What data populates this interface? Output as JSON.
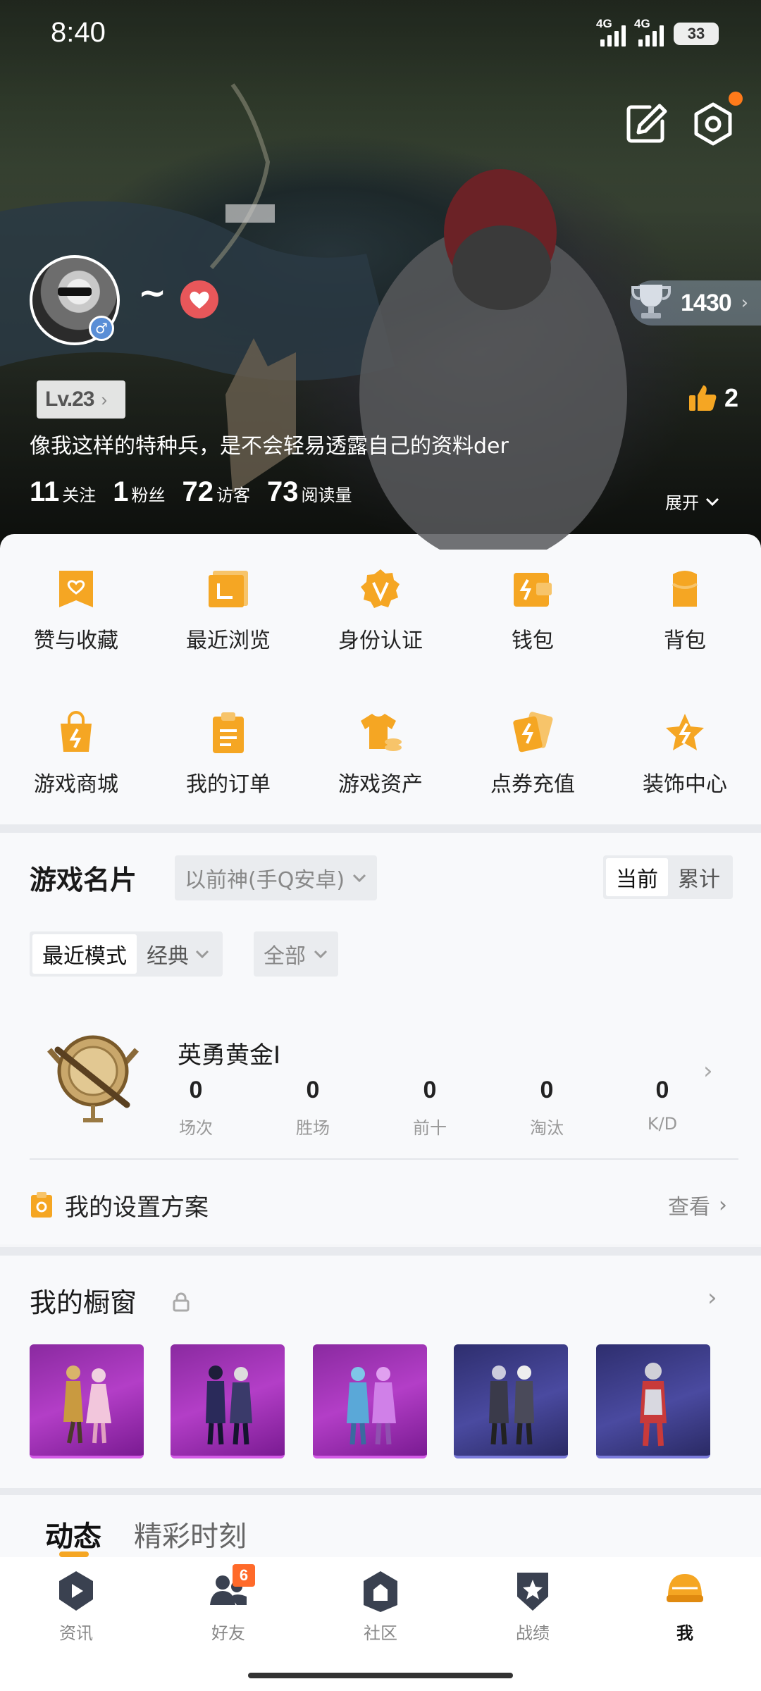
{
  "status_bar": {
    "time": "8:40",
    "network_1": "4G",
    "network_2": "4G",
    "battery": "33"
  },
  "profile": {
    "nickname": "~",
    "gender_symbol": "♂",
    "trophy_score": "1430",
    "level": "Lv.23",
    "likes": "2",
    "bio": "像我这样的特种兵，是不会轻易透露自己的资料der",
    "stats": [
      {
        "value": "11",
        "label": "关注"
      },
      {
        "value": "1",
        "label": "粉丝"
      },
      {
        "value": "72",
        "label": "访客"
      },
      {
        "value": "73",
        "label": "阅读量"
      }
    ],
    "expand_label": "展开"
  },
  "menu": [
    {
      "label": "赞与收藏",
      "icon": "bookmark-heart-icon"
    },
    {
      "label": "最近浏览",
      "icon": "recent-folder-icon"
    },
    {
      "label": "身份认证",
      "icon": "verified-badge-icon"
    },
    {
      "label": "钱包",
      "icon": "wallet-icon"
    },
    {
      "label": "背包",
      "icon": "backpack-icon"
    },
    {
      "label": "游戏商城",
      "icon": "shopping-bag-icon"
    },
    {
      "label": "我的订单",
      "icon": "clipboard-icon"
    },
    {
      "label": "游戏资产",
      "icon": "tshirt-coins-icon"
    },
    {
      "label": "点券充值",
      "icon": "coupon-cards-icon"
    },
    {
      "label": "装饰中心",
      "icon": "star-lightning-icon"
    }
  ],
  "game_card": {
    "title": "游戏名片",
    "account_dropdown": "以前神(手Q安卓)",
    "toggle": {
      "current": "当前",
      "cumulative": "累计"
    },
    "mode_recent": "最近模式",
    "mode_classic": "经典",
    "filter_all": "全部",
    "rank_name": "英勇黄金I",
    "rank_stats": [
      {
        "value": "0",
        "label": "场次"
      },
      {
        "value": "0",
        "label": "胜场"
      },
      {
        "value": "0",
        "label": "前十"
      },
      {
        "value": "0",
        "label": "淘汰"
      },
      {
        "value": "0",
        "label": "K/D"
      }
    ],
    "settings_label": "我的设置方案",
    "settings_action": "查看"
  },
  "showcase": {
    "title": "我的橱窗",
    "items": [
      {
        "theme": "purple"
      },
      {
        "theme": "purple"
      },
      {
        "theme": "purple"
      },
      {
        "theme": "blue"
      },
      {
        "theme": "blue"
      }
    ]
  },
  "tabs": {
    "active": "动态",
    "inactive": "精彩时刻"
  },
  "bottom_nav": [
    {
      "label": "资讯",
      "icon": "play-news-icon"
    },
    {
      "label": "好友",
      "icon": "friends-icon",
      "badge": "6"
    },
    {
      "label": "社区",
      "icon": "community-house-icon"
    },
    {
      "label": "战绩",
      "icon": "record-shield-icon"
    },
    {
      "label": "我",
      "icon": "helmet-icon"
    }
  ],
  "colors": {
    "accent": "#f5a623",
    "notification": "#ff7a1a",
    "heart": "#e8575a"
  }
}
